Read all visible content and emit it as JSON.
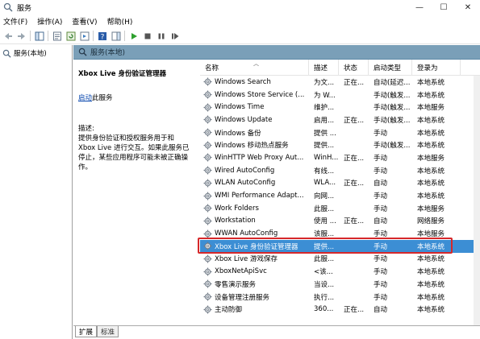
{
  "window": {
    "title": "服务",
    "icon": "gear-magnifier-icon",
    "controls": [
      "—",
      "☐",
      "✕"
    ]
  },
  "menu": [
    "文件(F)",
    "操作(A)",
    "查看(V)",
    "帮助(H)"
  ],
  "tree": {
    "root_label": "服务(本地)"
  },
  "main": {
    "header": "服务(本地)",
    "description": {
      "title": "Xbox Live 身份验证管理器",
      "action_link": "启动",
      "action_rest": "此服务",
      "label": "描述:",
      "text": "提供身份验证和授权服务用于和 Xbox Live 进行交互。如果此服务已停止，某些应用程序可能未被正确操作。"
    },
    "columns": [
      "名称",
      "描述",
      "状态",
      "启动类型",
      "登录为"
    ],
    "rows": [
      {
        "name": "Windows Search",
        "desc": "为文...",
        "status": "正在...",
        "start": "自动(延迟...",
        "login": "本地系统"
      },
      {
        "name": "Windows Store Service (...",
        "desc": "为 W...",
        "status": "",
        "start": "手动(触发...",
        "login": "本地系统"
      },
      {
        "name": "Windows Time",
        "desc": "维护...",
        "status": "",
        "start": "手动(触发...",
        "login": "本地服务"
      },
      {
        "name": "Windows Update",
        "desc": "启用...",
        "status": "正在...",
        "start": "手动(触发...",
        "login": "本地系统"
      },
      {
        "name": "Windows 备份",
        "desc": "提供 ...",
        "status": "",
        "start": "手动",
        "login": "本地系统"
      },
      {
        "name": "Windows 移动热点服务",
        "desc": "提供...",
        "status": "",
        "start": "手动(触发...",
        "login": "本地系统"
      },
      {
        "name": "WinHTTP Web Proxy Aut...",
        "desc": "WinH...",
        "status": "正在...",
        "start": "手动",
        "login": "本地服务"
      },
      {
        "name": "Wired AutoConfig",
        "desc": "有线...",
        "status": "",
        "start": "手动",
        "login": "本地系统"
      },
      {
        "name": "WLAN AutoConfig",
        "desc": "WLA...",
        "status": "正在...",
        "start": "自动",
        "login": "本地系统"
      },
      {
        "name": "WMI Performance Adapt...",
        "desc": "向网...",
        "status": "",
        "start": "手动",
        "login": "本地系统"
      },
      {
        "name": "Work Folders",
        "desc": "此服...",
        "status": "",
        "start": "手动",
        "login": "本地服务"
      },
      {
        "name": "Workstation",
        "desc": "使用 ...",
        "status": "正在...",
        "start": "自动",
        "login": "网络服务"
      },
      {
        "name": "WWAN AutoConfig",
        "desc": "该服...",
        "status": "",
        "start": "手动",
        "login": "本地服务"
      },
      {
        "name": "Xbox Live 身份验证管理器",
        "desc": "提供...",
        "status": "",
        "start": "手动",
        "login": "本地系统",
        "selected": true
      },
      {
        "name": "Xbox Live 游戏保存",
        "desc": "此服...",
        "status": "",
        "start": "手动",
        "login": "本地系统"
      },
      {
        "name": "XboxNetApiSvc",
        "desc": "<该...",
        "status": "",
        "start": "手动",
        "login": "本地系统"
      },
      {
        "name": "零售演示服务",
        "desc": "当设...",
        "status": "",
        "start": "手动",
        "login": "本地系统"
      },
      {
        "name": "设备管理注册服务",
        "desc": "执行...",
        "status": "",
        "start": "手动",
        "login": "本地系统"
      },
      {
        "name": "主动防御",
        "desc": "360...",
        "status": "正在...",
        "start": "自动",
        "login": "本地系统"
      }
    ]
  },
  "tabs": [
    "扩展",
    "标准"
  ],
  "colors": {
    "header_bg": "#7a9fb8",
    "selected_row": "#3c8ed4",
    "highlight_border": "#d6282a"
  }
}
